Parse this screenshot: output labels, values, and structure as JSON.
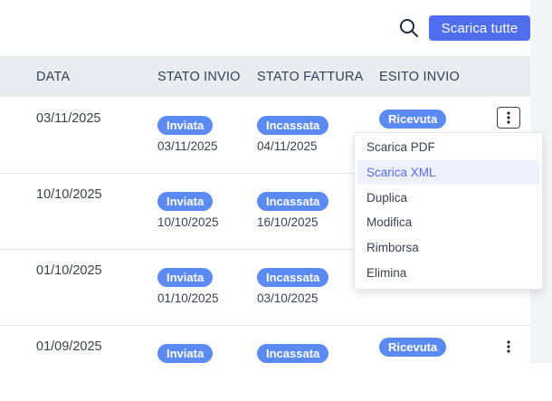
{
  "toolbar": {
    "download_all_label": "Scarica tutte"
  },
  "table": {
    "headers": {
      "date": "DATA",
      "send_status": "STATO INVIO",
      "invoice_status": "STATO FATTURA",
      "send_outcome": "ESITO INVIO"
    },
    "rows": [
      {
        "date": "03/11/2025",
        "send_status": "Inviata",
        "send_date": "03/11/2025",
        "invoice_status": "Incassata",
        "invoice_date": "04/11/2025",
        "outcome": "Ricevuta"
      },
      {
        "date": "10/10/2025",
        "send_status": "Inviata",
        "send_date": "10/10/2025",
        "invoice_status": "Incassata",
        "invoice_date": "16/10/2025"
      },
      {
        "date": "01/10/2025",
        "send_status": "Inviata",
        "send_date": "01/10/2025",
        "invoice_status": "Incassata",
        "invoice_date": "03/10/2025"
      },
      {
        "date": "01/09/2025",
        "send_status": "Inviata",
        "invoice_status": "Incassata",
        "outcome": "Ricevuta"
      }
    ]
  },
  "menu": {
    "items": [
      {
        "label": "Scarica PDF"
      },
      {
        "label": "Scarica XML"
      },
      {
        "label": "Duplica"
      },
      {
        "label": "Modifica"
      },
      {
        "label": "Rimborsa"
      },
      {
        "label": "Elimina"
      }
    ],
    "highlighted_index": 1
  },
  "colors": {
    "accent": "#4f6ef0",
    "badge": "#5b8af3",
    "header_bg": "#e8ebef",
    "menu_highlight_bg": "#eef1fd"
  },
  "icons": {
    "search": "search-icon",
    "more": "kebab-icon"
  }
}
